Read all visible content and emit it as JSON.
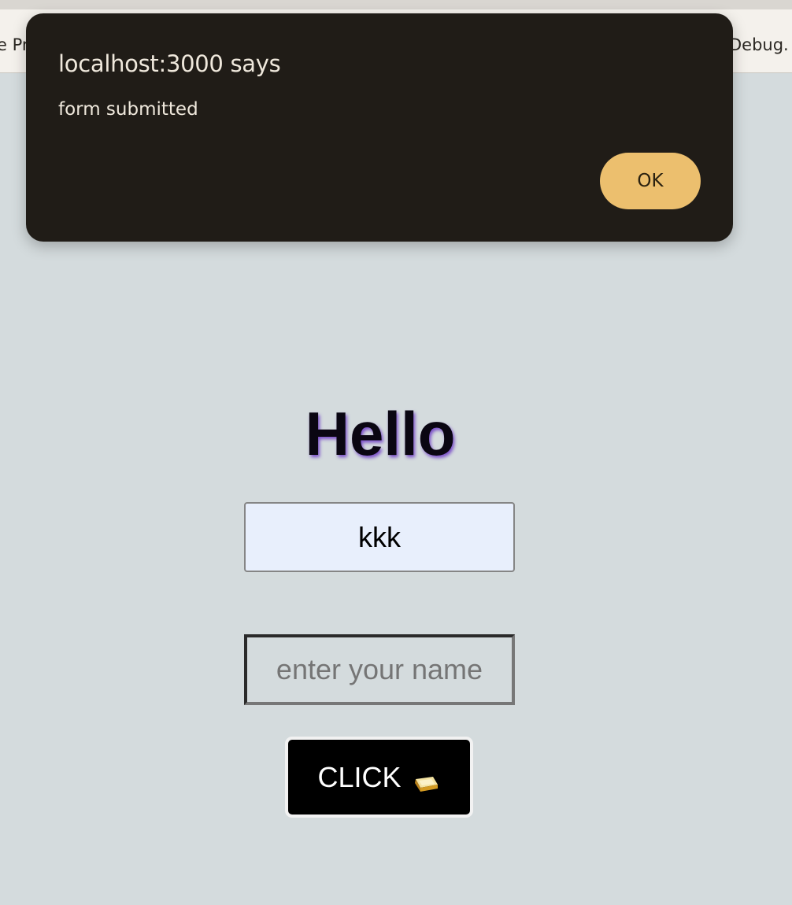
{
  "browser": {
    "bookmarks": {
      "left_fragment": "e Pr",
      "right_fragment": "Debug."
    }
  },
  "alert": {
    "title": "localhost:3000 says",
    "message": "form submitted",
    "ok_label": "OK",
    "background_color": "#201c17",
    "button_color": "#ecbf6e"
  },
  "page": {
    "heading": "Hello",
    "name_display_value": "kkk",
    "name_input_value": "",
    "name_input_placeholder": "enter your name",
    "button_label": "CLICK",
    "button_icon": "gold-bar-icon",
    "background_color": "#d4dbdd"
  }
}
